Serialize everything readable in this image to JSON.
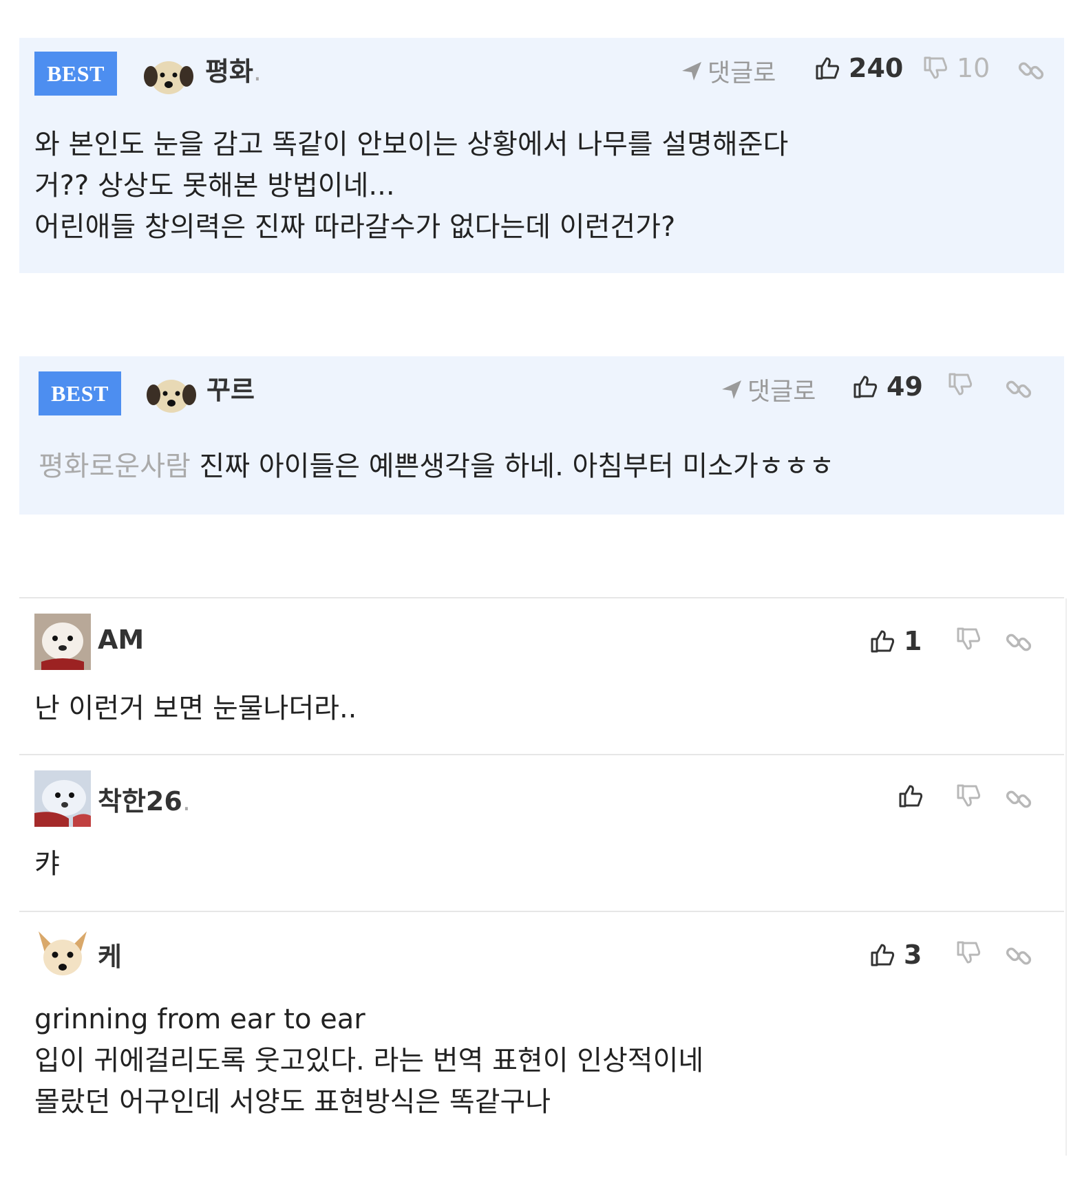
{
  "badge_label": "BEST",
  "reply_label": "댓글로",
  "comments": [
    {
      "best": true,
      "nickname": "평화",
      "likes": "240",
      "dislikes": "10",
      "mention": "",
      "text": "와 본인도 눈을 감고 똑같이 안보이는 상황에서 나무를 설명해준다\n거?? 상상도 못해본 방법이네...\n어린애들 창의력은 진짜 따라갈수가 없다는데 이런건가?"
    },
    {
      "best": true,
      "nickname": "꾸르",
      "likes": "49",
      "dislikes": "",
      "mention": "평화로운사람",
      "text": "진짜 아이들은 예쁜생각을 하네. 아침부터 미소가ㅎㅎㅎ"
    },
    {
      "best": false,
      "nickname": "AM",
      "likes": "1",
      "dislikes": "",
      "text": "난 이런거 보면 눈물나더라.."
    },
    {
      "best": false,
      "nickname": "착한26",
      "likes": "",
      "dislikes": "",
      "text": "캬"
    },
    {
      "best": false,
      "nickname": "케",
      "likes": "3",
      "dislikes": "",
      "text": "grinning from ear to ear\n입이 귀에걸리도록 웃고있다. 라는 번역 표현이 인상적이네\n몰랐던 어구인데 서양도 표현방식은 똑같구나"
    }
  ],
  "colors": {
    "best_background": "#eef4fd",
    "badge_background": "#4d8ef0",
    "muted_text": "#9a9a9a",
    "divider": "#e6e6e6"
  },
  "icons": [
    "send-arrow-icon",
    "thumbs-up-icon",
    "thumbs-down-icon",
    "link-icon",
    "puppy-avatar",
    "polar-bear-avatar",
    "chihuahua-avatar"
  ]
}
